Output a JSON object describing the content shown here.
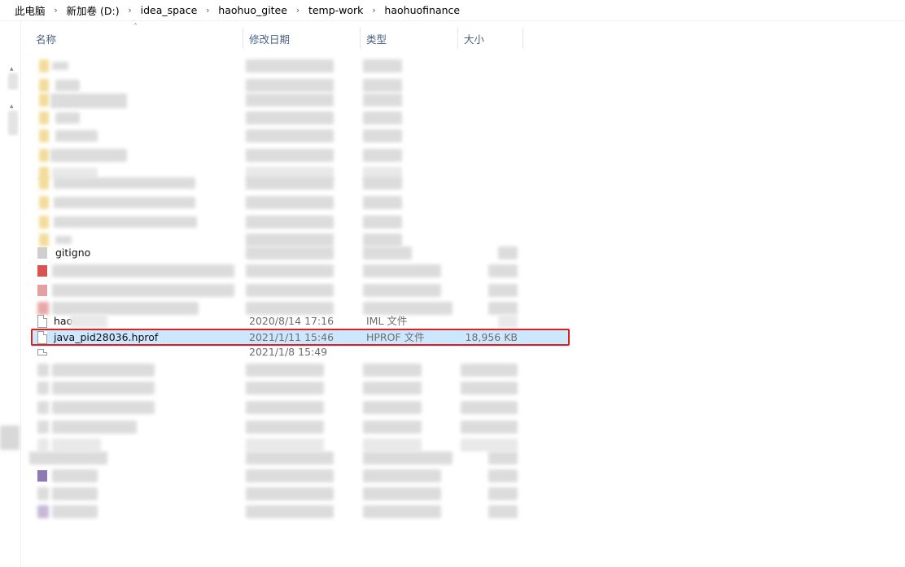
{
  "breadcrumb": [
    {
      "label": "此电脑"
    },
    {
      "label": "新加卷 (D:)"
    },
    {
      "label": "idea_space"
    },
    {
      "label": "haohuo_gitee"
    },
    {
      "label": "temp-work"
    },
    {
      "label": "haohuofinance"
    }
  ],
  "columns": {
    "name": "名称",
    "date": "修改日期",
    "type": "类型",
    "size": "大小"
  },
  "rows": {
    "gitignore_partial": {
      "name": "gitigno"
    },
    "iml": {
      "name": "haoh",
      "date": "2020/8/14 17:16",
      "type": "IML 文件"
    },
    "hprof": {
      "name": "java_pid28036.hprof",
      "date": "2021/1/11 15:46",
      "type": "HPROF 文件",
      "size": "18,956 KB"
    },
    "after_partial": {
      "date": "2021/1/8 15:49"
    }
  }
}
